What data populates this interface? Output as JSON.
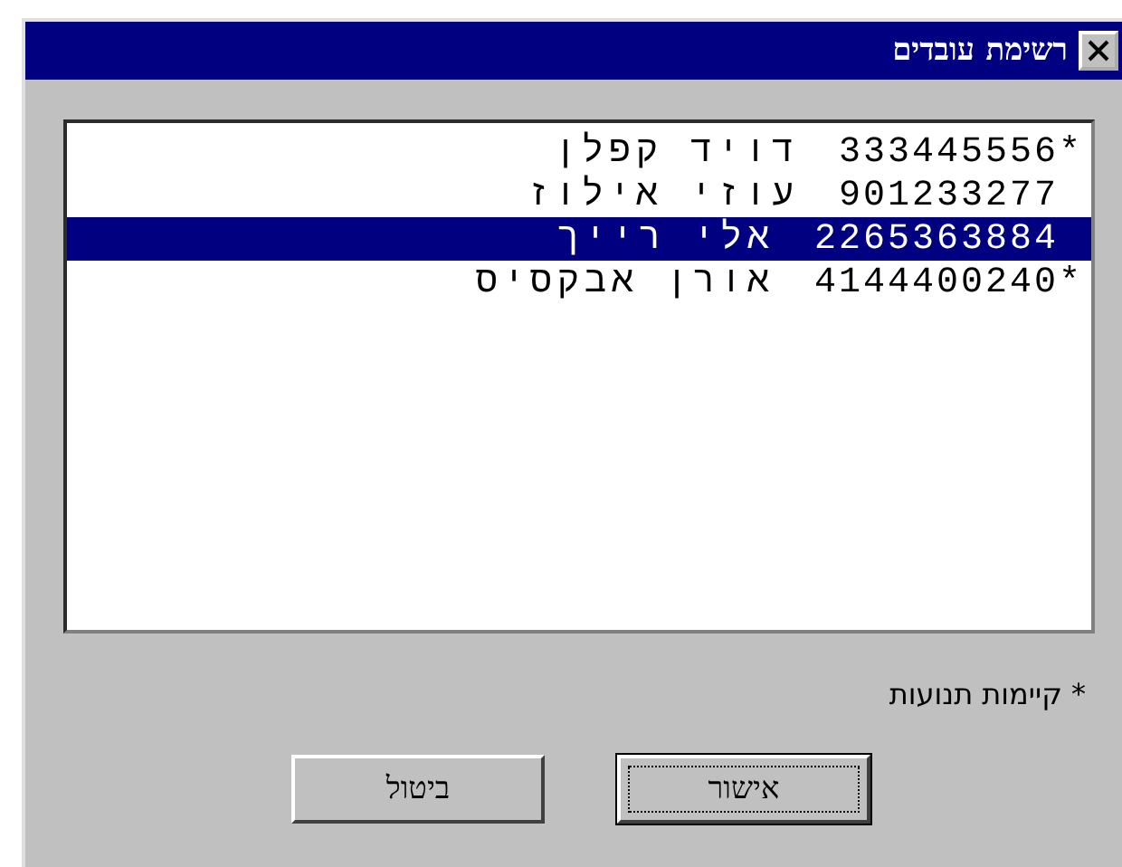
{
  "window": {
    "title": "רשימת עובדים"
  },
  "list": {
    "rows": [
      {
        "name": "דויד קפלן",
        "number": "333445556",
        "flag": "*",
        "selected": false
      },
      {
        "name": "עוזי אילוז",
        "number": "901233277",
        "selected": false
      },
      {
        "name": "אלי רייך",
        "number": "2265363884",
        "selected": true
      },
      {
        "name": "אורן אבקסיס",
        "number": "4144400240",
        "flag": "*",
        "selected": false
      }
    ]
  },
  "footnote": "* קיימות תנועות",
  "buttons": [
    {
      "label": "אישור",
      "default": true
    },
    {
      "label": "ביטול",
      "default": false
    }
  ]
}
